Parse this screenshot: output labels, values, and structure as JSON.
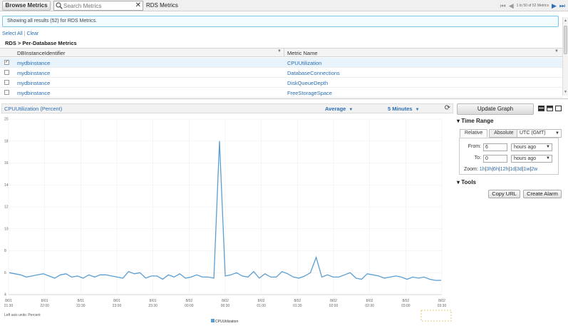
{
  "topbar": {
    "browse_label": "Browse Metrics",
    "search_placeholder": "Search Metrics",
    "context": "RDS Metrics",
    "pager_text": "1 to 50 of 52 Metrics"
  },
  "info": {
    "text": "Showing all results (52) for RDS Metrics."
  },
  "selection": {
    "select_all": "Select All",
    "sep": "|",
    "clear": "Clear"
  },
  "breadcrumb": "RDS > Per-Database Metrics",
  "table": {
    "columns": [
      "DBInstanceIdentifier",
      "Metric Name"
    ],
    "rows": [
      {
        "id": "mydbinstance",
        "metric": "CPUUtilization",
        "checked": true
      },
      {
        "id": "mydbinstance",
        "metric": "DatabaseConnections",
        "checked": false
      },
      {
        "id": "mydbinstance",
        "metric": "DiskQueueDepth",
        "checked": false
      },
      {
        "id": "mydbinstance",
        "metric": "FreeStorageSpace",
        "checked": false
      }
    ]
  },
  "chart_header": {
    "title": "CPUUtilization (Percent)",
    "statistic": "Average",
    "period": "5 Minutes"
  },
  "chart_data": {
    "type": "line",
    "ylim": [
      4,
      20
    ],
    "yticks": [
      4,
      6,
      8,
      10,
      12,
      14,
      16,
      18,
      20
    ],
    "xticks": [
      [
        "8/01",
        "21:30"
      ],
      [
        "8/01",
        "22:00"
      ],
      [
        "8/01",
        "22:30"
      ],
      [
        "8/01",
        "23:00"
      ],
      [
        "8/01",
        "23:30"
      ],
      [
        "8/02",
        "00:00"
      ],
      [
        "8/02",
        "00:30"
      ],
      [
        "8/02",
        "01:00"
      ],
      [
        "8/02",
        "01:30"
      ],
      [
        "8/02",
        "02:00"
      ],
      [
        "8/02",
        "02:30"
      ],
      [
        "8/02",
        "03:00"
      ],
      [
        "8/02",
        "03:30"
      ]
    ],
    "left_axis_label": "Left axis units: Percent",
    "legend": "CPUUtilization",
    "series": [
      {
        "name": "CPUUtilization",
        "color": "#5a9ed2",
        "values": [
          6.0,
          5.9,
          5.8,
          5.6,
          5.7,
          5.8,
          5.9,
          5.7,
          5.5,
          5.8,
          5.9,
          5.6,
          5.7,
          5.5,
          5.8,
          5.6,
          5.8,
          5.8,
          5.7,
          5.6,
          5.5,
          6.1,
          5.9,
          6.0,
          5.5,
          5.7,
          5.7,
          5.4,
          5.8,
          5.6,
          5.9,
          5.5,
          5.6,
          5.8,
          5.6,
          5.6,
          5.5,
          18.0,
          5.7,
          5.8,
          6.0,
          5.7,
          5.6,
          6.1,
          5.5,
          5.9,
          5.6,
          5.6,
          6.1,
          5.9,
          5.6,
          5.5,
          5.7,
          6.0,
          7.4,
          5.6,
          5.8,
          5.6,
          5.6,
          5.8,
          6.0,
          5.5,
          5.4,
          5.9,
          5.8,
          5.7,
          5.5,
          5.6,
          5.7,
          5.6,
          5.4,
          5.6,
          5.5,
          5.6,
          5.4,
          5.3,
          5.3
        ]
      }
    ]
  },
  "panel": {
    "update_label": "Update Graph",
    "time_range_title": "Time Range",
    "tabs": [
      "Relative",
      "Absolute"
    ],
    "timezone": "UTC (GMT)",
    "from_label": "From:",
    "from_value": "6",
    "from_unit": "hours ago",
    "to_label": "To:",
    "to_value": "0",
    "to_unit": "hours ago",
    "zoom_label": "Zoom:",
    "zoom_options": [
      "1h",
      "3h",
      "6h",
      "12h",
      "1d",
      "3d",
      "1w",
      "2w"
    ],
    "tools_title": "Tools",
    "copy_url": "Copy URL",
    "create_alarm": "Create Alarm"
  }
}
